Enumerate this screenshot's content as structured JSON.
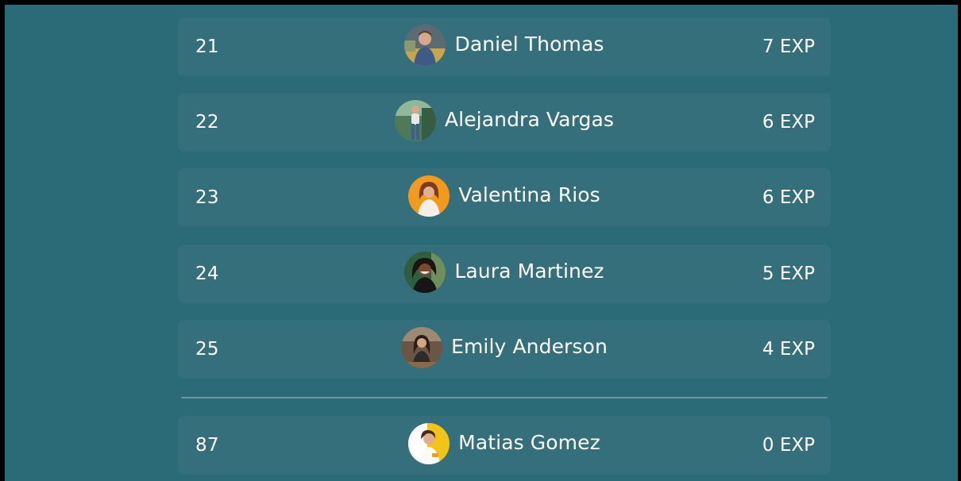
{
  "leaderboard": {
    "rows": [
      {
        "rank": "21",
        "name": "Daniel Thomas",
        "exp": "7 EXP",
        "avatar": "daniel-thomas-avatar"
      },
      {
        "rank": "22",
        "name": "Alejandra Vargas",
        "exp": "6 EXP",
        "avatar": "alejandra-vargas-avatar"
      },
      {
        "rank": "23",
        "name": "Valentina Rios",
        "exp": "6 EXP",
        "avatar": "valentina-rios-avatar"
      },
      {
        "rank": "24",
        "name": "Laura Martinez",
        "exp": "5 EXP",
        "avatar": "laura-martinez-avatar"
      },
      {
        "rank": "25",
        "name": "Emily Anderson",
        "exp": "4 EXP",
        "avatar": "emily-anderson-avatar"
      }
    ],
    "current_user": {
      "rank": "87",
      "name": "Matias Gomez",
      "exp": "0 EXP",
      "avatar": "matias-gomez-avatar"
    }
  },
  "colors": {
    "background": "#2b6a77",
    "row": "#356f7b",
    "text": "#ffffff",
    "divider": "#7fa9b2"
  }
}
